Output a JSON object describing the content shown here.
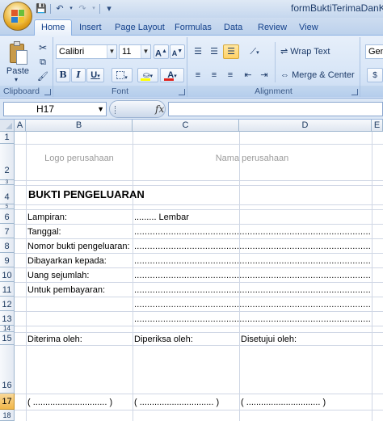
{
  "window": {
    "title": "formBuktiTerimaDanKel"
  },
  "qat": {
    "save": "💾",
    "undo": "↶",
    "redo": "↷",
    "customize": "▾"
  },
  "tabs": [
    "Home",
    "Insert",
    "Page Layout",
    "Formulas",
    "Data",
    "Review",
    "View"
  ],
  "ribbon": {
    "clipboard": {
      "label": "Clipboard",
      "paste": "Paste",
      "cut_icon": "scissors-icon",
      "copy_icon": "copy-icon",
      "format_painter_icon": "brush-icon"
    },
    "font": {
      "label": "Font",
      "font_name": "Calibri",
      "font_size": "11",
      "grow": "A",
      "shrink": "A",
      "bold": "B",
      "italic": "I",
      "underline": "U",
      "font_color_glyph": "A",
      "highlight_color": "#ffff00",
      "font_color": "#e0201a"
    },
    "alignment": {
      "label": "Alignment",
      "wrap_text": "Wrap Text",
      "merge_center": "Merge & Center"
    },
    "number": {
      "format": "Gene"
    }
  },
  "formula_bar": {
    "name_box": "H17",
    "fx": "fx",
    "formula": ""
  },
  "columns": [
    "A",
    "B",
    "C",
    "D",
    "E"
  ],
  "rows": [
    "1",
    "2",
    "3",
    "4",
    "5",
    "6",
    "7",
    "8",
    "9",
    "10",
    "11",
    "12",
    "13",
    "14",
    "15",
    "16",
    "17",
    "18"
  ],
  "selected_row": "17",
  "sheet": {
    "logo": "Logo perusahaan",
    "company": "Nama perusahaan",
    "heading": "BUKTI PENGELUARAN",
    "lampiran_label": "Lampiran:",
    "lampiran_value": "......... Lembar",
    "tanggal_label": "Tanggal:",
    "nomor_label": "Nomor bukti pengeluaran:",
    "dibayarkan_label": "Dibayarkan kepada:",
    "uang_label": "Uang sejumlah:",
    "untuk_label": "Untuk pembayaran:",
    "dots": "............................................................................................................",
    "diterima": "Diterima oleh:",
    "diperiksa": "Diperiksa oleh:",
    "disetujui": "Disetujui oleh:",
    "sign_b": "( .............................. )",
    "sign_c": "( .............................. )",
    "sign_d": "( .............................. )"
  }
}
